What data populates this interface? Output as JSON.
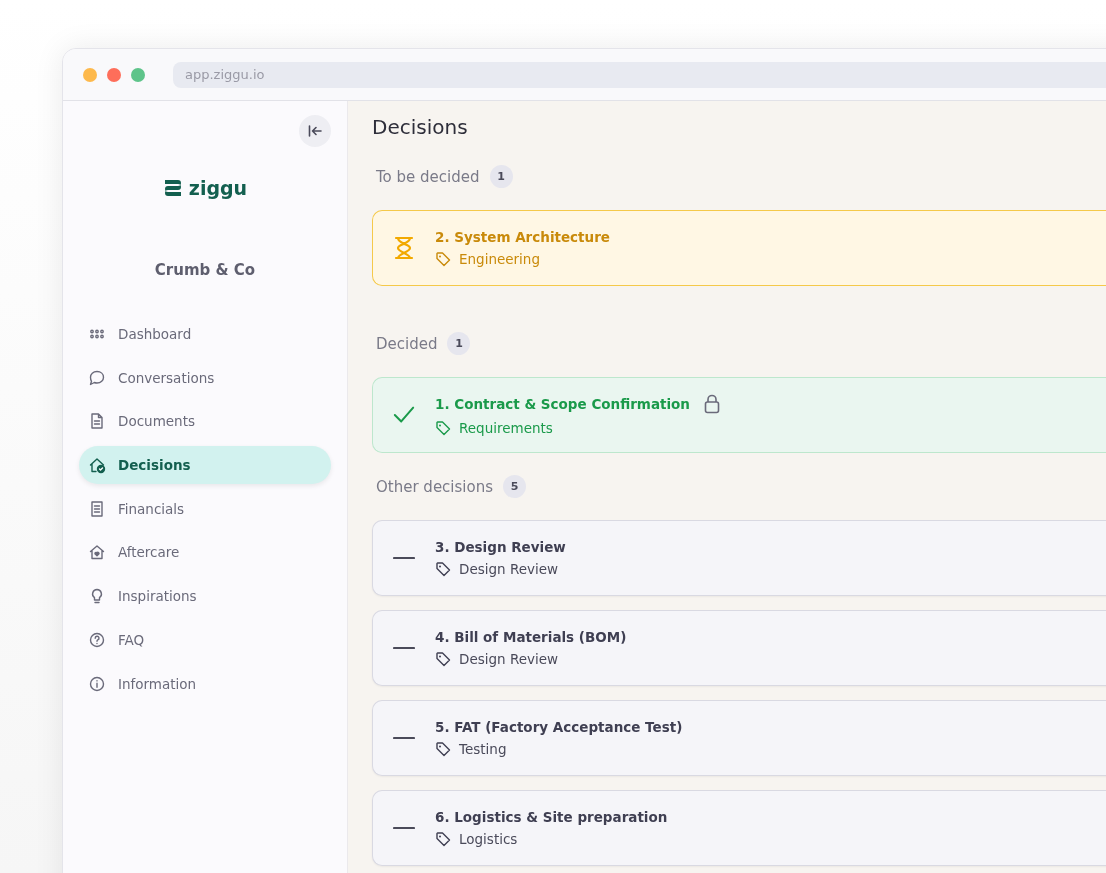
{
  "browser": {
    "url": "app.ziggu.io"
  },
  "sidebar": {
    "logo": "ziggu",
    "company": "Crumb & Co",
    "items": [
      {
        "label": "Dashboard",
        "selected": false
      },
      {
        "label": "Conversations",
        "selected": false
      },
      {
        "label": "Documents",
        "selected": false
      },
      {
        "label": "Decisions",
        "selected": true
      },
      {
        "label": "Financials",
        "selected": false
      },
      {
        "label": "Aftercare",
        "selected": false
      },
      {
        "label": "Inspirations",
        "selected": false
      },
      {
        "label": "FAQ",
        "selected": false
      },
      {
        "label": "Information",
        "selected": false
      }
    ]
  },
  "page": {
    "title": "Decisions",
    "sections": [
      {
        "title": "To be decided",
        "count": "1",
        "decisions": [
          {
            "kind": "pending",
            "title": "2. System Architecture",
            "tag": "Engineering",
            "locked": false
          }
        ]
      },
      {
        "title": "Decided",
        "count": "1",
        "decisions": [
          {
            "kind": "decided",
            "title": "1. Contract & Scope Confirmation",
            "tag": "Requirements",
            "locked": true
          }
        ]
      },
      {
        "title": "Other decisions",
        "count": "5",
        "decisions": [
          {
            "kind": "other",
            "title": "3. Design Review",
            "tag": "Design Review",
            "locked": false
          },
          {
            "kind": "other",
            "title": "4. Bill of Materials (BOM)",
            "tag": "Design Review",
            "locked": false
          },
          {
            "kind": "other",
            "title": "5. FAT (Factory Acceptance Test)",
            "tag": "Testing",
            "locked": false
          },
          {
            "kind": "other",
            "title": "6. Logistics & Site preparation",
            "tag": "Logistics",
            "locked": false
          }
        ]
      }
    ]
  }
}
